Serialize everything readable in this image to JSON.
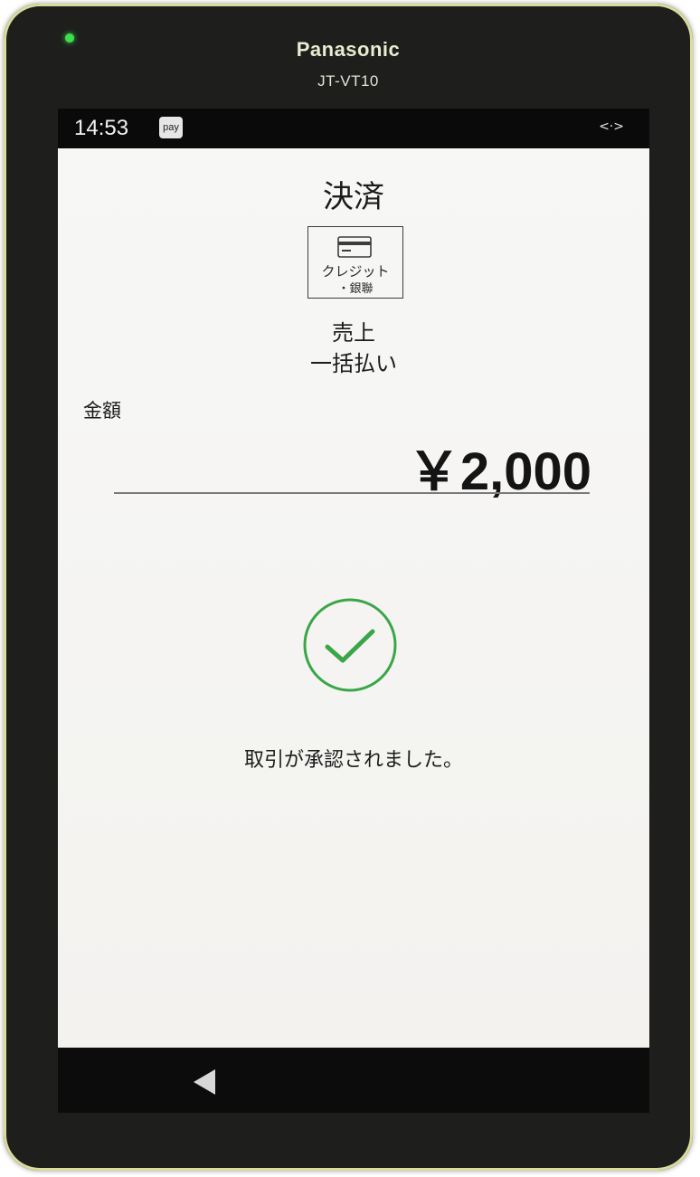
{
  "device": {
    "brand": "Panasonic",
    "model": "JT-VT10",
    "led_color": "#3be04a"
  },
  "status_bar": {
    "time": "14:53",
    "pay_badge": "pay",
    "network_icon": "<·>"
  },
  "screen": {
    "title": "決済",
    "payment_method": {
      "icon": "credit-card-icon",
      "line1": "クレジット",
      "line2": "・銀聯"
    },
    "transaction_type": "売上",
    "payment_type": "一括払い",
    "amount_label": "金額",
    "amount_value": "￥2,000",
    "result_icon": "check-circle-icon",
    "result_color": "#3aa648",
    "result_message": "取引が承認されました。"
  },
  "nav_bar": {
    "back_icon": "back-triangle-icon"
  }
}
